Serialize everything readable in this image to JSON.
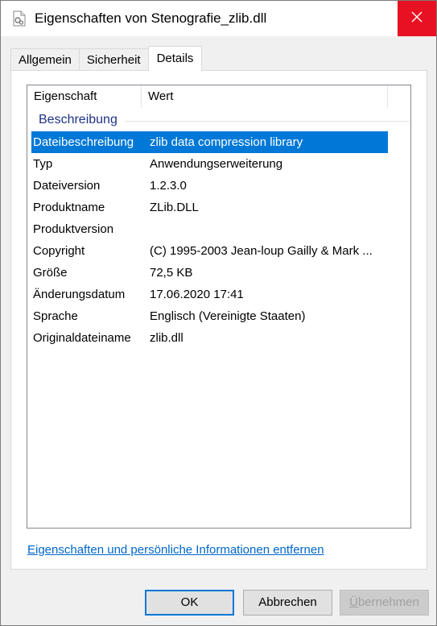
{
  "window": {
    "title": "Eigenschaften von Stenografie_zlib.dll",
    "close_icon": "close-icon",
    "file_icon": "dll-file-icon"
  },
  "tabs": [
    {
      "label": "Allgemein",
      "active": false
    },
    {
      "label": "Sicherheit",
      "active": false
    },
    {
      "label": "Details",
      "active": true
    }
  ],
  "details": {
    "columns": [
      "Eigenschaft",
      "Wert"
    ],
    "group": "Beschreibung",
    "rows": [
      {
        "key": "Dateibeschreibung",
        "value": "zlib data compression library",
        "selected": true
      },
      {
        "key": "Typ",
        "value": "Anwendungserweiterung"
      },
      {
        "key": "Dateiversion",
        "value": "1.2.3.0"
      },
      {
        "key": "Produktname",
        "value": "ZLib.DLL"
      },
      {
        "key": "Produktversion",
        "value": ""
      },
      {
        "key": "Copyright",
        "value": "(C) 1995-2003 Jean-loup Gailly & Mark ..."
      },
      {
        "key": "Größe",
        "value": "72,5 KB"
      },
      {
        "key": "Änderungsdatum",
        "value": "17.06.2020 17:41"
      },
      {
        "key": "Sprache",
        "value": "Englisch (Vereinigte Staaten)"
      },
      {
        "key": "Originaldateiname",
        "value": "zlib.dll"
      }
    ],
    "selection_color": "#0078d7"
  },
  "remove_link": "Eigenschaften und persönliche Informationen entfernen",
  "buttons": {
    "ok": "OK",
    "cancel": "Abbrechen",
    "apply_prefix": "Ü",
    "apply_rest": "bernehmen"
  },
  "colors": {
    "close_button": "#e81123",
    "link": "#0066cc",
    "group_header": "#1e3287"
  }
}
